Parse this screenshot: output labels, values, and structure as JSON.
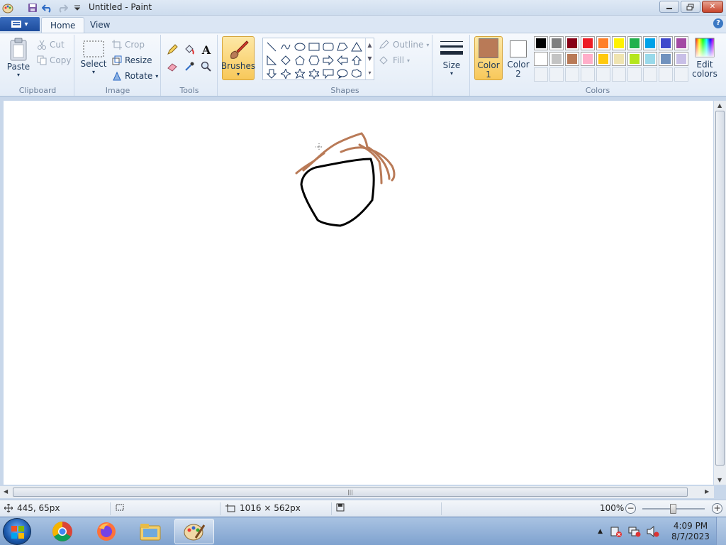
{
  "window": {
    "title": "Untitled - Paint"
  },
  "ribbon": {
    "tabs": [
      {
        "label": "Home"
      },
      {
        "label": "View"
      }
    ],
    "clipboard": {
      "paste": "Paste",
      "cut": "Cut",
      "copy": "Copy",
      "group": "Clipboard"
    },
    "image": {
      "select": "Select",
      "crop": "Crop",
      "resize": "Resize",
      "rotate": "Rotate",
      "group": "Image"
    },
    "tools": {
      "group": "Tools"
    },
    "brushes": {
      "label": "Brushes"
    },
    "shapes": {
      "outline": "Outline",
      "fill": "Fill",
      "group": "Shapes"
    },
    "size": {
      "label": "Size"
    },
    "colors": {
      "color1_line1": "Color",
      "color1_line2": "1",
      "color2_line1": "Color",
      "color2_line2": "2",
      "edit_line1": "Edit",
      "edit_line2": "colors",
      "group": "Colors",
      "color1": "#b97a57",
      "color2": "#ffffff",
      "palette_row1": [
        "#000000",
        "#7f7f7f",
        "#880015",
        "#ed1c24",
        "#ff7f27",
        "#fff200",
        "#22b14c",
        "#00a2e8",
        "#3f48cc",
        "#a349a4"
      ],
      "palette_row2": [
        "#ffffff",
        "#c3c3c3",
        "#b97a57",
        "#ffaec9",
        "#ffc90e",
        "#efe4b0",
        "#b5e61d",
        "#99d9ea",
        "#7092be",
        "#c8bfe7"
      ]
    }
  },
  "status": {
    "cursor_pos": "445, 65px",
    "canvas_size": "1016 × 562px",
    "zoom": "100%"
  },
  "taskbar": {
    "time": "4:09 PM",
    "date": "8/7/2023"
  }
}
